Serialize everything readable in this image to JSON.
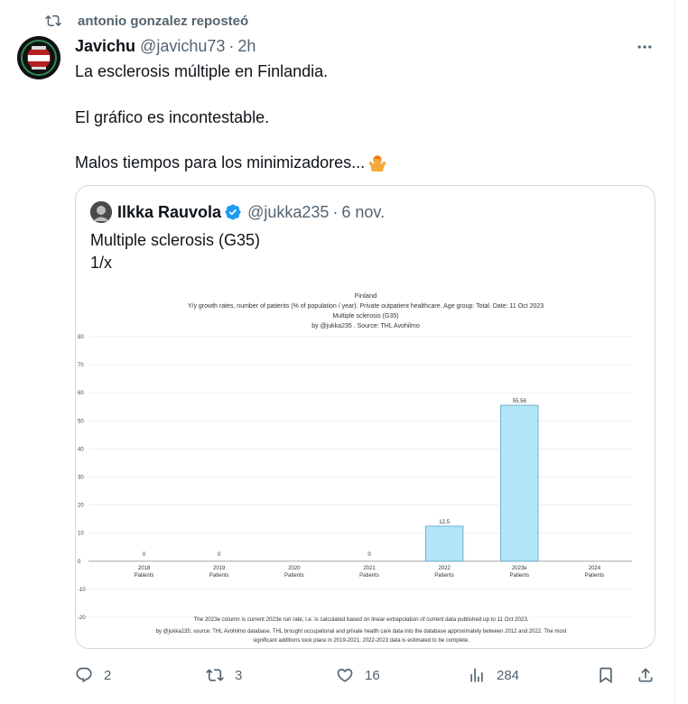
{
  "repost": {
    "text": "antonio gonzalez reposteó",
    "icon": "repost-icon"
  },
  "tweet": {
    "author_name": "Javichu",
    "author_handle": "@javichu73",
    "separator": "·",
    "time": "2h",
    "lines": [
      "La esclerosis múltiple en Finlandia.",
      "El gráfico es incontestable.",
      "Malos tiempos para los minimizadores..."
    ],
    "emoji": "person-shrugging-emoji"
  },
  "quote": {
    "author_name": "Ilkka Rauvola",
    "author_handle": "@jukka235",
    "separator": "·",
    "date": "6 nov.",
    "lines": [
      "Multiple sclerosis (G35)",
      "1/x"
    ]
  },
  "chart_data": {
    "type": "bar",
    "title": "Finland",
    "subtitle_lines": [
      "Y/y growth rates, number of patients (% of population / year).  Private outpatient healthcare. Age group: Total. Date: 11 Oct 2023",
      "Multiple sclerosis (G35)",
      "by @jukka235 . Source: THL Avohilmo"
    ],
    "categories": [
      "2018",
      "2019",
      "2020",
      "2021",
      "2022",
      "2023e",
      "2024"
    ],
    "category_sublabel": "Patients",
    "values": [
      0,
      0,
      null,
      0,
      12.5,
      55.56,
      null
    ],
    "data_labels": [
      "0",
      "0",
      "",
      "0",
      "12.5",
      "55.56",
      ""
    ],
    "ylim": [
      -20,
      80
    ],
    "yticks": [
      "80",
      "70",
      "60",
      "50",
      "40",
      "30",
      "20",
      "10",
      "0",
      "-10",
      "-20"
    ],
    "grid": true,
    "bar_color": "#b3e5f9",
    "bar_edge_color": "#5aa5c7",
    "footnote_lines": [
      "The 2023e column is current 2023e run rate, i.e. is calculated based on linear extrapolation of current  data published up to 11 Oct 2023.",
      "by @jukka235; source: THL Avohilmo database. THL brought occupational and private health care data into the database approximately between 2012 and 2022. The most",
      "significant additions took place in 2019-2021; 2022-2023 data is estimated to be complete."
    ]
  },
  "actions": {
    "reply_count": "2",
    "repost_count": "3",
    "like_count": "16",
    "views_count": "284"
  },
  "colors": {
    "secondary_text": "#536471",
    "verified_blue": "#1d9bf0",
    "border": "#cfd9de"
  }
}
